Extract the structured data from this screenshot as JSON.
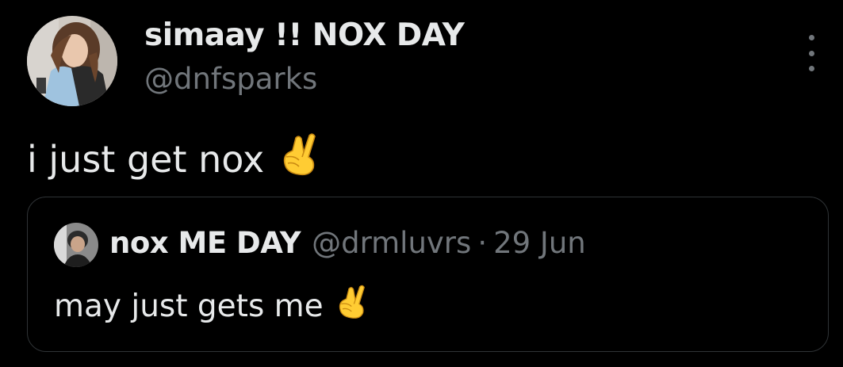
{
  "tweet": {
    "author": {
      "display_name": "simaay !! NOX DAY",
      "handle": "@dnfsparks",
      "avatar": "profile-photo"
    },
    "text": "i just get nox",
    "emoji": "crossed-fingers",
    "more_icon": "more-vertical-icon"
  },
  "quoted_tweet": {
    "author": {
      "display_name": "nox ME DAY",
      "handle": "@drmluvrs",
      "avatar": "profile-photo"
    },
    "separator": "·",
    "date": "29 Jun",
    "text": "may just gets me",
    "emoji": "crossed-fingers"
  },
  "colors": {
    "background": "#000000",
    "primary_text": "#e7e9ea",
    "secondary_text": "#71767b",
    "border": "#2f3336",
    "emoji_yellow": "#ffcc33"
  }
}
